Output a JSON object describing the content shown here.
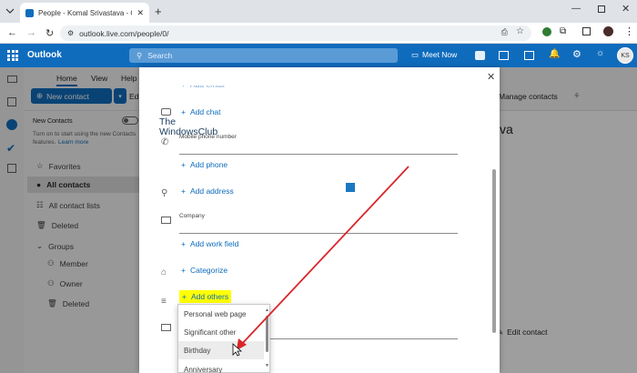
{
  "browser": {
    "tab_title": "People - Komal Srivastava - Ou",
    "url": "outlook.live.com/people/0/"
  },
  "header": {
    "brand": "Outlook",
    "search_placeholder": "Search",
    "meet_now": "Meet Now",
    "avatar_initials": "KS",
    "accent": "#0f6cbd"
  },
  "ribbon": {
    "tabs": [
      "Home",
      "View",
      "Help"
    ],
    "new_contact": "New contact",
    "edit_partial": "Edi",
    "manage_contacts": "Manage contacts"
  },
  "sidebar": {
    "new_contacts_title": "New Contacts",
    "new_contacts_desc_1": "Turn on to start using the new Contacts",
    "new_contacts_desc_2": "features.",
    "learn_more": "Learn more",
    "items": [
      {
        "label": "Favorites",
        "icon": "star-icon"
      },
      {
        "label": "All contacts",
        "icon": "person-icon"
      },
      {
        "label": "All contact lists",
        "icon": "people-list-icon"
      },
      {
        "label": "Deleted",
        "icon": "trash-icon"
      }
    ],
    "groups_label": "Groups",
    "group_items": [
      {
        "label": "Member",
        "icon": "people-icon"
      },
      {
        "label": "Owner",
        "icon": "people-icon"
      },
      {
        "label": "Deleted",
        "icon": "trash-icon"
      }
    ]
  },
  "background": {
    "name_fragment": "va",
    "edit_contact": "Edit contact"
  },
  "modal": {
    "add_email_partial": "Add email",
    "add_chat": "Add chat",
    "mobile_phone_label": "Mobile phone number",
    "add_phone": "Add phone",
    "add_address": "Add address",
    "company_label": "Company",
    "add_work_field": "Add work field",
    "categorize": "Categorize",
    "add_others": "Add others",
    "highlight_color": "#ffff00",
    "dropdown_options": [
      "Personal web page",
      "Significant other",
      "Birthday",
      "Anniversary"
    ],
    "dropdown_selected": "Birthday"
  },
  "watermark": {
    "line1": "The",
    "line2": "WindowsClub"
  },
  "arrow_color": "#d9252a"
}
